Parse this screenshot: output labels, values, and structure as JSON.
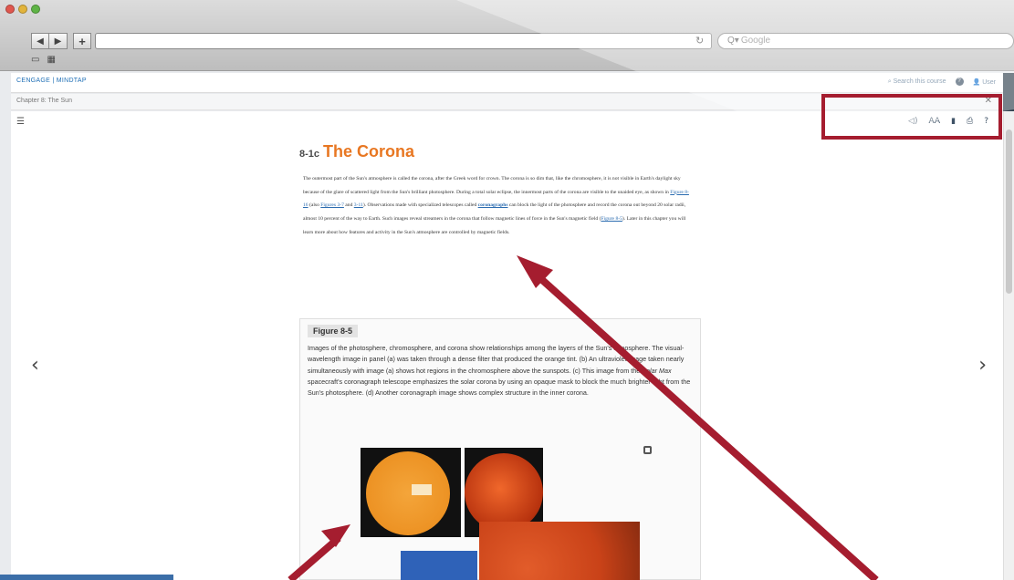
{
  "browser": {
    "search_placeholder": "Google",
    "reload_icon": "reload-icon"
  },
  "app": {
    "logo": "CENGAGE | MINDTAP",
    "header_search": "Search this course",
    "header_user": "User"
  },
  "breadcrumb": "Chapter 8: The Sun",
  "toolbar": {
    "items": [
      "tts-icon",
      "text-size-icon",
      "bookmark-icon",
      "print-icon",
      "help-icon"
    ],
    "labels": [
      "◁)",
      "AA",
      "▮",
      "⎙",
      "?"
    ]
  },
  "article": {
    "section_number": "8-1c",
    "title": "The Corona",
    "paragraph_parts": {
      "p1": "The outermost part of the Sun's atmosphere is called the corona, after the Greek word for crown. The corona is so dim that, like the chromosphere, it is not visible in Earth's daylight sky because of the glare of scattered light from the Sun's brilliant photosphere. During a total solar eclipse, the innermost parts of the corona are visible to the unaided eye, as shown in ",
      "link1": "Figure 8-16",
      "p2": " (also ",
      "link2": "Figures 3-7",
      "p3": " and ",
      "link3": "3-11",
      "p4": "). Observations made with specialized telescopes called ",
      "term": "coronagraphs",
      "p5": " can block the light of the photosphere and record the corona out beyond 20 solar radii, almost 10 percent of the way to Earth. Such images reveal streamers in the corona that follow magnetic lines of force in the Sun's magnetic field (",
      "link4": "Figure 8-5",
      "p6": "). Later in this chapter you will learn more about how features and activity in the Sun's atmosphere are controlled by magnetic fields."
    }
  },
  "figure": {
    "label": "Figure 8-5",
    "caption_1": "Images of the photosphere, chromosphere, and corona show relationships among the layers of the Sun's atmosphere. The visual-wavelength image in panel (a) was taken through a dense filter that produced the orange tint. (b) An ultraviolet image taken nearly simultaneously with image (a) shows hot regions in the chromosphere above the sunspots. (c) This image from the ",
    "caption_italic": "Solar Max",
    "caption_2": " spacecraft's coronagraph telescope emphasizes the solar corona by using an opaque mask to block the much brighter light from the Sun's photosphere. (d) Another coronagraph image shows complex structure in the inner corona."
  },
  "colors": {
    "accent_orange": "#e87722",
    "annotation_red": "#a51d2f",
    "link_blue": "#2b6cb0"
  }
}
